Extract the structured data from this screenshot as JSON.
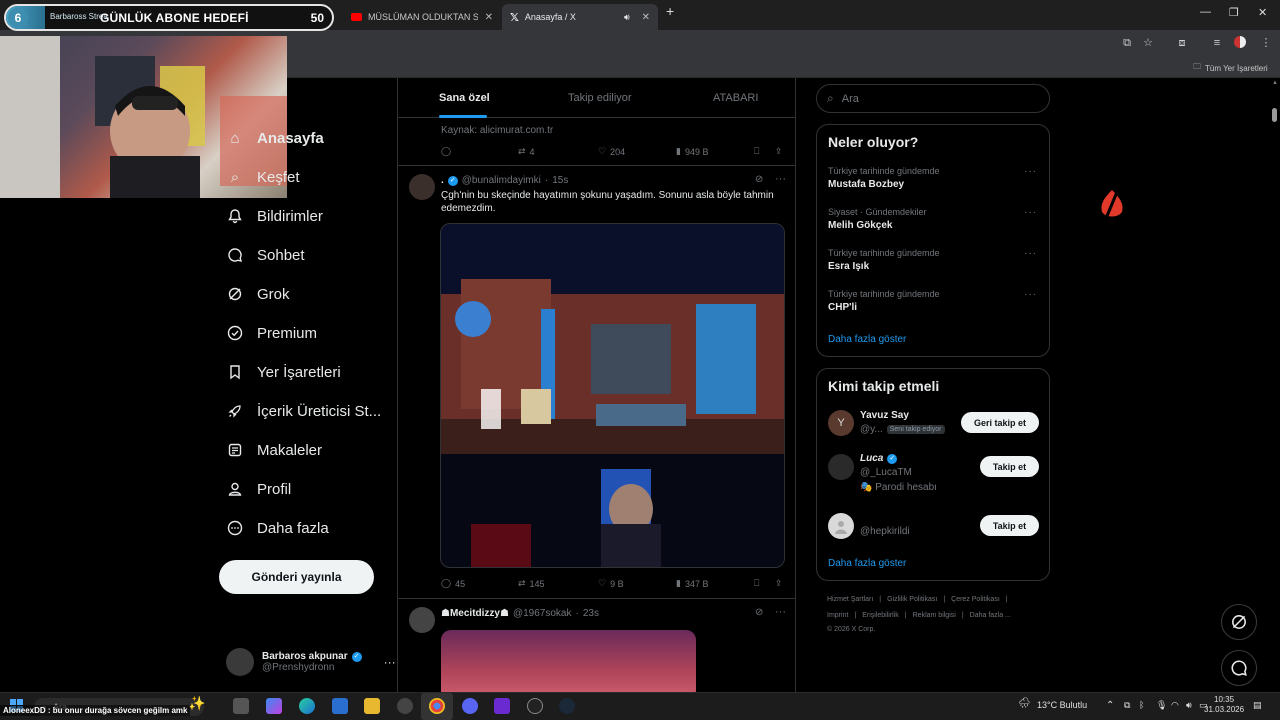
{
  "overlay": {
    "goal_current": "6",
    "goal_channel": "Barbaross Strea",
    "goal_title": "GÜNLÜK ABONE HEDEFİ",
    "goal_target": "50",
    "goal_progress": 0.12
  },
  "browser": {
    "tabs": [
      {
        "label": "MÜSLÜMAN OLDUKTAN SONR",
        "icon": "youtube-icon"
      },
      {
        "label": "Anasayfa / X",
        "icon": "x-logo-icon"
      }
    ],
    "bookmarks_label": "Tüm Yer İşaretleri"
  },
  "nav": {
    "items": [
      {
        "label": "Anasayfa",
        "icon": "home-icon"
      },
      {
        "label": "Keşfet",
        "icon": "search-icon"
      },
      {
        "label": "Bildirimler",
        "icon": "bell-icon"
      },
      {
        "label": "Sohbet",
        "icon": "chat-icon"
      },
      {
        "label": "Grok",
        "icon": "grok-icon"
      },
      {
        "label": "Premium",
        "icon": "premium-icon"
      },
      {
        "label": "Yer İşaretleri",
        "icon": "bookmark-icon"
      },
      {
        "label": "İçerik Üreticisi St...",
        "icon": "rocket-icon"
      },
      {
        "label": "Makaleler",
        "icon": "article-icon"
      },
      {
        "label": "Profil",
        "icon": "person-icon"
      },
      {
        "label": "Daha fazla",
        "icon": "more-circle-icon"
      }
    ],
    "post_button": "Gönderi yayınla",
    "me": {
      "name": "Barbaros akpunar",
      "handle": "@Prenshydronn"
    }
  },
  "feed": {
    "tabs": [
      "Sana özel",
      "Takip ediliyor",
      "ATABARI"
    ],
    "prev_post": {
      "source": "Kaynak: alicimurat.com.tr",
      "retweets": "4",
      "likes": "204",
      "views": "949 B"
    },
    "post": {
      "name": ".",
      "handle": "@bunalimdayimki",
      "time": "15s",
      "text": "Çgh'nin bu skeçinde hayatımın şokunu yaşadım. Sonunu asla böyle tahmin edemezdim.",
      "replies": "45",
      "retweets": "145",
      "likes": "9 B",
      "views": "347 B"
    },
    "next_post": {
      "name": "☗Mecitdizzy☗",
      "handle": "@1967sokak",
      "time": "23s"
    }
  },
  "right": {
    "search_placeholder": "Ara",
    "trends_title": "Neler oluyor?",
    "trends": [
      {
        "context": "Türkiye tarihinde gündemde",
        "title": "Mustafa Bozbey"
      },
      {
        "context": "Siyaset · Gündemdekiler",
        "title": "Melih Gökçek"
      },
      {
        "context": "Türkiye tarihinde gündemde",
        "title": "Esra Işık"
      },
      {
        "context": "Türkiye tarihinde gündemde",
        "title": "CHP'li"
      }
    ],
    "show_more": "Daha fazla göster",
    "who_title": "Kimi takip etmeli",
    "who": [
      {
        "initial": "Y",
        "name": "Yavuz Say",
        "handle": "@y...",
        "badge": "Seni takip ediyor",
        "button": "Geri takip et"
      },
      {
        "initial": "",
        "name": "Luca",
        "handle": "@_LucaTM",
        "sub": "🎭 Parodi hesabı",
        "button": "Takip et"
      },
      {
        "initial": "",
        "name": "",
        "handle": "@hepkirildi",
        "button": "Takip et"
      }
    ],
    "who_more": "Daha fazla göster",
    "footer": [
      "Hizmet Şartları",
      "Gizlilik Politikası",
      "Çerez Politikası",
      "Imprint",
      "Erişilebilirlik",
      "Reklam bilgisi",
      "Daha fazla ...",
      "© 2026 X Corp."
    ]
  },
  "taskbar": {
    "search": "Ara",
    "weather": "13°C  Bulutlu",
    "time": "10:35",
    "date": "31.03.2026",
    "chat": "AloneexDD : bu onur durağa sövcen geğilm amk"
  }
}
